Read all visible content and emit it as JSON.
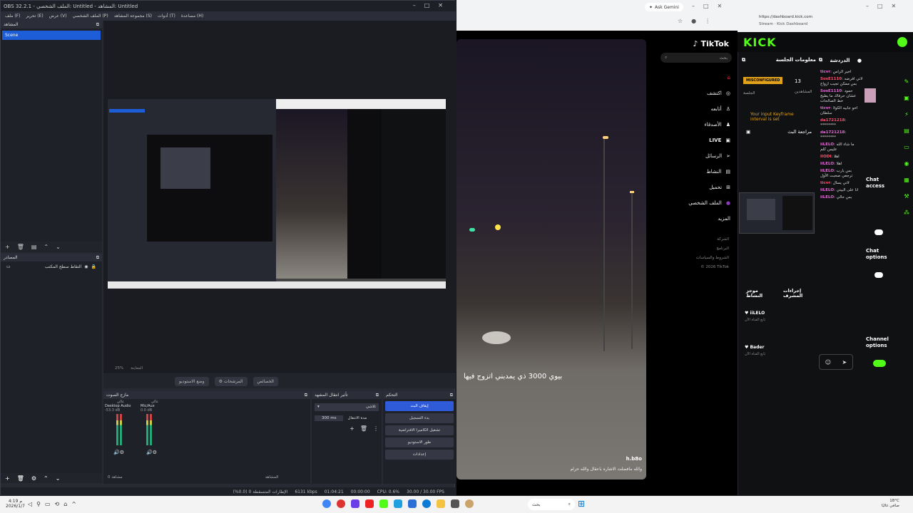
{
  "obs": {
    "title": "OBS 32.2.1 - الملف الشخصي: Untitled - المشاهد: Untitled",
    "menu": [
      "ملف (F)",
      "تحرير (E)",
      "عرض (V)",
      "الملف الشخصي (P)",
      "مجموعة المشاهد (S)",
      "أدوات (T)",
      "مساعدة (H)"
    ],
    "scenes_title": "المشاهد",
    "scene_item": "Scene",
    "sources_title": "المصادر",
    "source_item": "التقاط سطح المكتب",
    "zoom": "25%",
    "preview_label": "المعاينة",
    "btn_studio": "وضع الاستوديو",
    "btn_filters": "المرشحات",
    "btn_props": "الخصائص",
    "mixer_title": "مازج الصوت",
    "trans_title": "تأثير انتقال المشهد",
    "controls_title": "التحكم",
    "tracks": [
      {
        "name": "Desktop Audio",
        "db": "-53.3 dB",
        "label": "عالي"
      },
      {
        "name": "Mic/Aux",
        "db": "0.0 dB",
        "label": "عالي"
      }
    ],
    "trans_select": "تلاشي",
    "duration_label": "مدة الانتقال",
    "duration_value": "300 ms",
    "controls": [
      "إيقاف البث",
      "بدء التسجيل",
      "تشغيل الكاميرا الافتراضية",
      "طور الاستوديو",
      "إعدادات"
    ],
    "status": [
      "الإطارات المتسقطة 0 (0.0%)",
      "6131 kbps",
      "01:04:21",
      "00:00:00",
      "CPU: 0.6%",
      "30.00 / 30.00 FPS"
    ],
    "bottom_left": "مشاهد 0",
    "bottom_mid": "المشاهد"
  },
  "chrome": {
    "gemini": "Ask Gemini"
  },
  "tiktok": {
    "logo": "TikTok",
    "search": "بحث",
    "nav": [
      "اكتشف",
      "أتابعه",
      "الأصدقاء",
      "LIVE",
      "الرسائل",
      "النشاط",
      "تحميل",
      "الملف الشخصي",
      "المزيد"
    ],
    "foot": [
      "الشركة",
      "البرنامج",
      "الشروط والسياسات",
      "© 2026 TikTok"
    ],
    "caption": "بيوي 3000 ذي يمدبني اتزوج فيها",
    "user": "h.b8o",
    "desc": "والله مافضلت الاشاره باعقال والله حرام"
  },
  "kick": {
    "url": "https://dashboard.kick.com",
    "tab": "Stream · Kick Dashboard",
    "logo": "KICK",
    "session_title": "معلومات الجلسة",
    "chat_title": "الدردشة",
    "badge": "MISCONFIGURED",
    "session_lbl": "الجلسة",
    "viewers": "13",
    "viewers_lbl": "المشاهدين",
    "keyframe": "Your input Keyframe interval is set",
    "review": "مراجعة البث",
    "chat_access": "Chat access",
    "chat_options": "Chat options",
    "channel_options": "Channel options",
    "mod_actions": "إجراءات المشرف",
    "activity": "موجز النشاط",
    "chat": [
      {
        "u": "ticvr",
        "t": "اخير الراس"
      },
      {
        "u": "SosE1110",
        "t": "لاتي افرضه بس ممكن تجيب ازواج"
      },
      {
        "u": "SosE1110",
        "t": "حمود عشان حرفاك ما يطيح خط الصالحات"
      },
      {
        "u": "ticvr",
        "t": "اخو جابيه الكولا سلطان"
      },
      {
        "u": "da1721218",
        "t": "********"
      },
      {
        "u": "da1721218",
        "t": "********"
      },
      {
        "u": "iiLELO",
        "t": "ما شاء الله عليس كلم"
      },
      {
        "u": "IIODI",
        "t": "اهلا"
      },
      {
        "u": "iiLELO",
        "t": "اهلا"
      },
      {
        "u": "iiLELO",
        "t": "بس يارب ترجعي صحبت الأول"
      },
      {
        "u": "ticvr",
        "t": "لاتي يسال"
      },
      {
        "u": "iiLELO",
        "t": "انا على البيتي"
      },
      {
        "u": "iiLELO",
        "t": "بس حالي"
      }
    ],
    "feed": [
      {
        "u": "iiLELO",
        "t": "تابع القناة الآن"
      },
      {
        "u": "Bader",
        "t": "تابع القناة الآن"
      }
    ]
  },
  "taskbar": {
    "search": "بحث",
    "time": "4:19 م",
    "date": "2026/1/7",
    "weather": "18°C",
    "weather2": "صافي غالبًا"
  }
}
